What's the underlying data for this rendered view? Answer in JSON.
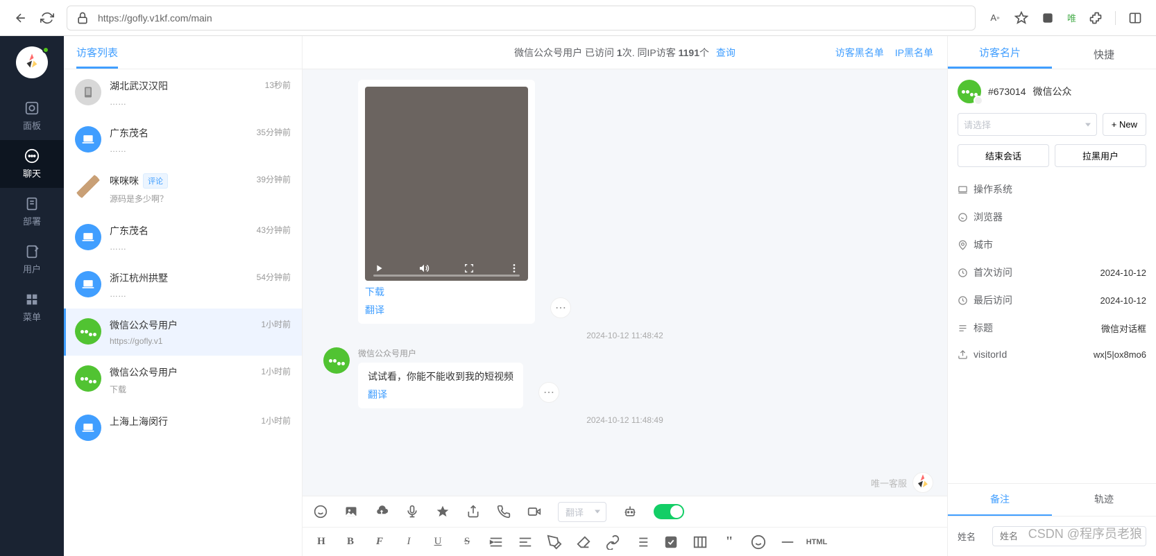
{
  "browser": {
    "url": "https://gofly.v1kf.com/main",
    "wei_label": "唯"
  },
  "sidenav": {
    "items": [
      {
        "label": "面板"
      },
      {
        "label": "聊天"
      },
      {
        "label": "部署"
      },
      {
        "label": "用户"
      },
      {
        "label": "菜单"
      }
    ],
    "activeIndex": 1
  },
  "visitors": {
    "tab": "访客列表",
    "list": [
      {
        "name": "湖北武汉汉阳",
        "tag": null,
        "sub": "……",
        "time": "13秒前",
        "avatar": "img",
        "selected": false
      },
      {
        "name": "广东茂名",
        "tag": null,
        "sub": "……",
        "time": "35分钟前",
        "avatar": "desktop",
        "selected": false
      },
      {
        "name": "咪咪咪",
        "tag": "评论",
        "sub": "源码是多少啊？",
        "time": "39分钟前",
        "avatar": "cat",
        "selected": false
      },
      {
        "name": "广东茂名",
        "tag": null,
        "sub": "……",
        "time": "43分钟前",
        "avatar": "desktop",
        "selected": false
      },
      {
        "name": "浙江杭州拱墅",
        "tag": null,
        "sub": "……",
        "time": "54分钟前",
        "avatar": "desktop",
        "selected": false
      },
      {
        "name": "微信公众号用户",
        "tag": null,
        "sub": "https://gofly.v1",
        "time": "1小时前",
        "avatar": "wechat",
        "selected": true
      },
      {
        "name": "微信公众号用户",
        "tag": null,
        "sub": "下载",
        "time": "1小时前",
        "avatar": "wechat",
        "selected": false
      },
      {
        "name": "上海上海闵行",
        "tag": null,
        "sub": "",
        "time": "1小时前",
        "avatar": "desktop",
        "selected": false
      }
    ]
  },
  "chat": {
    "header_prefix": "微信公众号用户 已访问 ",
    "header_visit_count": "1",
    "header_mid": "次.  同IP访客  ",
    "header_same_ip": "1191",
    "header_suffix": "个",
    "header_query": "查询",
    "blacklist_visitor": "访客黑名单",
    "blacklist_ip": "IP黑名单",
    "download_link": "下载",
    "translate_link": "翻译",
    "time1": "2024-10-12 11:48:42",
    "msg2_name": "微信公众号用户",
    "msg2_text": "试试看，你能不能收到我的短视频",
    "msg2_translate": "翻译",
    "time2": "2024-10-12 11:48:49",
    "signature": "唯一客服",
    "translate_select": "翻译",
    "html_btn": "HTML"
  },
  "right": {
    "tab1": "访客名片",
    "tab2": "快捷",
    "user_id": "#673014",
    "user_type": "微信公众",
    "select_placeholder": "请选择",
    "new_btn": "+ New",
    "end_session": "结束会话",
    "blacklist_user": "拉黑用户",
    "details": [
      {
        "label": "操作系统",
        "value": ""
      },
      {
        "label": "浏览器",
        "value": ""
      },
      {
        "label": "城市",
        "value": ""
      },
      {
        "label": "首次访问",
        "value": "2024-10-12"
      },
      {
        "label": "最后访问",
        "value": "2024-10-12"
      },
      {
        "label": "标题",
        "value": "微信对话框"
      },
      {
        "label": "visitorId",
        "value": "wx|5|ox8mo6"
      }
    ],
    "footer_tab1": "备注",
    "footer_tab2": "轨迹",
    "name_label": "姓名",
    "name_placeholder": "姓名"
  },
  "watermark": "CSDN @程序员老狼"
}
